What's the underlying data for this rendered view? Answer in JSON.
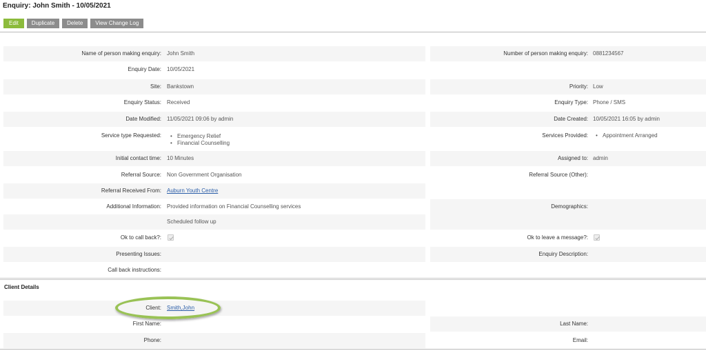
{
  "page": {
    "title": "Enquiry: John Smith - 10/05/2021"
  },
  "toolbar": {
    "edit": "Edit",
    "duplicate": "Duplicate",
    "delete": "Delete",
    "change_log": "View Change Log"
  },
  "enquiry": {
    "name_label": "Name of person making enquiry:",
    "name_value": "John Smith",
    "number_label": "Number of person making enquiry:",
    "number_value": "0881234567",
    "date_label": "Enquiry Date:",
    "date_value": "10/05/2021",
    "site_label": "Site:",
    "site_value": "Bankstown",
    "priority_label": "Priority:",
    "priority_value": "Low",
    "status_label": "Enquiry Status:",
    "status_value": "Received",
    "type_label": "Enquiry Type:",
    "type_value": "Phone / SMS",
    "modified_label": "Date Modified:",
    "modified_value": "11/05/2021 09:06 by admin",
    "created_label": "Date Created:",
    "created_value": "10/05/2021 16:05 by admin",
    "service_req_label": "Service type Requested:",
    "service_req_items": [
      "Emergency Relief",
      "Financial Counselling"
    ],
    "services_provided_label": "Services Provided:",
    "services_provided_items": [
      "Appointment Arranged"
    ],
    "initial_contact_label": "Initial contact time:",
    "initial_contact_value": "10 Minutes",
    "assigned_label": "Assigned to:",
    "assigned_value": "admin",
    "ref_source_label": "Referral Source:",
    "ref_source_value": "Non Government Organisation",
    "ref_source_other_label": "Referral Source (Other):",
    "ref_source_other_value": "",
    "ref_from_label": "Referral Received From:",
    "ref_from_value": "Auburn Youth Centre",
    "additional_label": "Additional Information:",
    "additional_line1": "Provided information on Financial Counselling services",
    "additional_line2": "Scheduled follow up",
    "demographics_label": "Demographics:",
    "ok_call_label": "Ok to call back?:",
    "ok_call_checked": true,
    "ok_message_label": "Ok to leave a message?:",
    "ok_message_checked": true,
    "presenting_label": "Presenting Issues:",
    "description_label": "Enquiry Description:",
    "callback_label": "Call back instructions:"
  },
  "client": {
    "section_title": "Client Details",
    "client_label": "Client:",
    "client_value": "Smith,John",
    "first_name_label": "First Name:",
    "last_name_label": "Last Name:",
    "phone_label": "Phone:",
    "email_label": "Email:"
  },
  "colors": {
    "edit_button": "#8cbb3c",
    "secondary_button": "#8c8c8c",
    "link": "#2a5da8",
    "highlight": "#99c255",
    "row_shade": "#f5f5f5"
  }
}
